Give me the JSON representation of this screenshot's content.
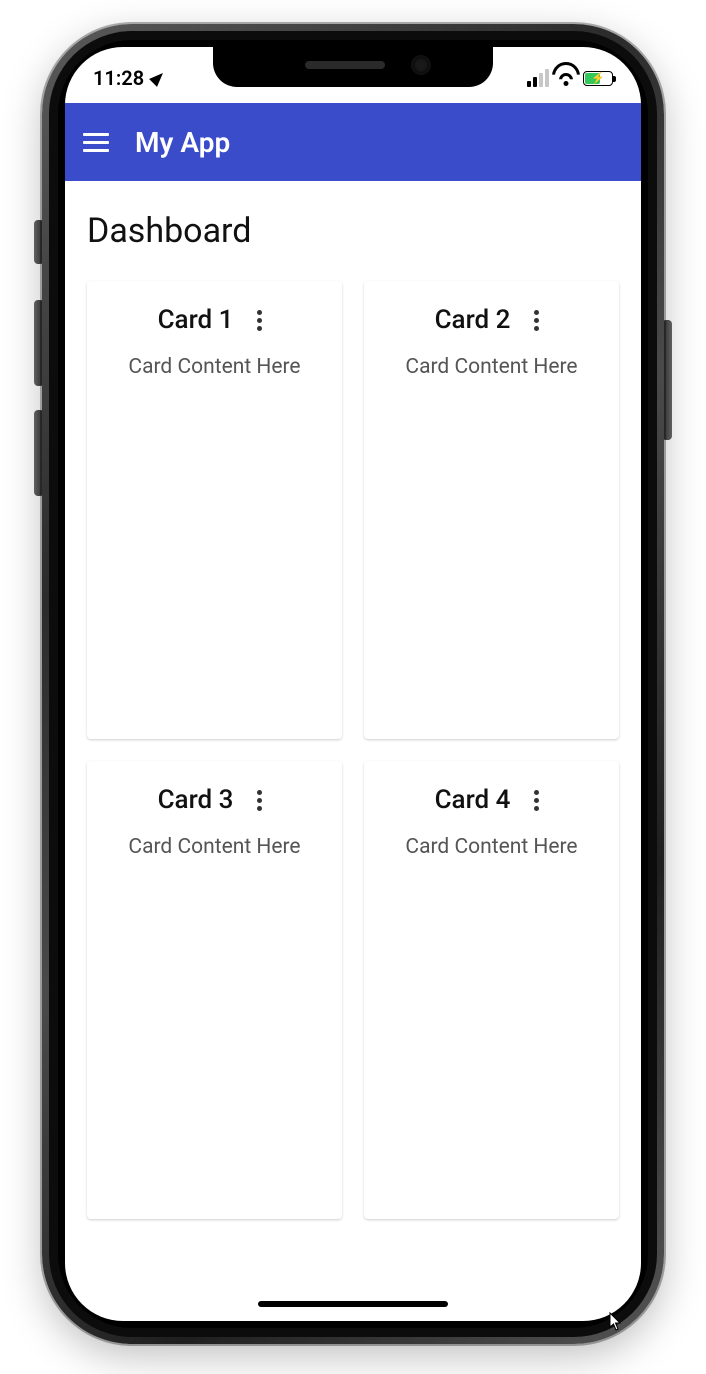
{
  "status": {
    "time": "11:28",
    "location_services": true,
    "signal_bars_active": 2,
    "wifi": true,
    "battery_charging": true
  },
  "appbar": {
    "title": "My App"
  },
  "page": {
    "title": "Dashboard"
  },
  "cards": [
    {
      "title": "Card 1",
      "content": "Card Content Here"
    },
    {
      "title": "Card 2",
      "content": "Card Content Here"
    },
    {
      "title": "Card 3",
      "content": "Card Content Here"
    },
    {
      "title": "Card 4",
      "content": "Card Content Here"
    }
  ],
  "colors": {
    "primary": "#3b4cca",
    "battery_fill": "#34c759"
  }
}
